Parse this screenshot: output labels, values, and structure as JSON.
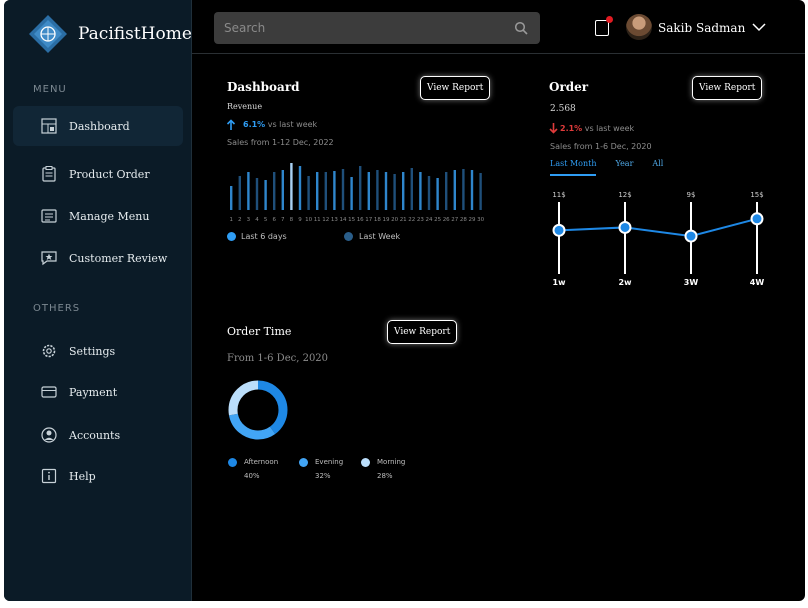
{
  "app": {
    "name": "PacifistHome"
  },
  "sidebar": {
    "menu_label": "MENU",
    "others_label": "OTHERS",
    "menu_items": [
      {
        "label": "Dashboard",
        "icon": "dashboard-icon",
        "active": true
      },
      {
        "label": "Product Order",
        "icon": "clipboard-icon"
      },
      {
        "label": "Manage Menu",
        "icon": "menu-list-icon"
      },
      {
        "label": "Customer Review",
        "icon": "review-icon"
      }
    ],
    "other_items": [
      {
        "label": "Settings",
        "icon": "gear-icon"
      },
      {
        "label": "Payment",
        "icon": "card-icon"
      },
      {
        "label": "Accounts",
        "icon": "user-icon"
      },
      {
        "label": "Help",
        "icon": "help-icon"
      }
    ]
  },
  "topbar": {
    "search_placeholder": "Search",
    "user_name": "Sakib Sadman"
  },
  "dashboard": {
    "title": "Dashboard",
    "view_report": "View Report",
    "revenue_label": "Revenue",
    "change": "6.1%",
    "change_text": "vs last week",
    "range": "Sales from 1-12 Dec, 2022",
    "legend": [
      "Last 6 days",
      "Last Week"
    ]
  },
  "order": {
    "title": "Order",
    "view_report": "View Report",
    "value": "2.568",
    "change": "2.1%",
    "change_text": "vs last week",
    "range": "Sales from 1-6 Dec, 2020",
    "tabs": [
      "Last Month",
      "Year",
      "All"
    ]
  },
  "order_time": {
    "title": "Order Time",
    "view_report": "View Report",
    "range": "From 1-6 Dec, 2020",
    "legend": [
      {
        "label": "Afternoon",
        "pct": "40%",
        "color": "#1e88e5"
      },
      {
        "label": "Evening",
        "pct": "32%",
        "color": "#42a5f5"
      },
      {
        "label": "Morning",
        "pct": "28%",
        "color": "#bbdefb"
      }
    ]
  },
  "colors": {
    "accent": "#2f9df4",
    "bar_dark": "#1f4f7a",
    "bar_light": "#2f86cc",
    "bar_highlight": "#a9d2f5",
    "negative": "#e03b3b"
  },
  "chart_data": [
    {
      "type": "bar",
      "categories": [
        "1",
        "2",
        "3",
        "4",
        "5",
        "6",
        "7",
        "8",
        "9",
        "10",
        "11",
        "12",
        "13",
        "14",
        "15",
        "16",
        "17",
        "18",
        "19",
        "20",
        "21",
        "22",
        "23",
        "24",
        "25",
        "26",
        "27",
        "28",
        "29",
        "30"
      ],
      "series": [
        {
          "name": "Last 6 days",
          "values": [
            24,
            34,
            38,
            32,
            30,
            38,
            40,
            47,
            44,
            34,
            38,
            38,
            39,
            41,
            33,
            44,
            38,
            40,
            38,
            36,
            38,
            42,
            38,
            34,
            32,
            38,
            40,
            41,
            40,
            37
          ]
        }
      ],
      "highlight_index": 7
    },
    {
      "type": "line",
      "x": [
        "1w",
        "2w",
        "3W",
        "4W"
      ],
      "series": [
        {
          "values": [
            11,
            12,
            9,
            15
          ]
        }
      ],
      "point_labels": [
        "11$",
        "12$",
        "9$",
        "15$"
      ],
      "ylim": [
        0,
        25
      ]
    },
    {
      "type": "pie",
      "donut": true,
      "labels": [
        "Afternoon",
        "Evening",
        "Morning"
      ],
      "values": [
        40,
        32,
        28
      ]
    }
  ]
}
